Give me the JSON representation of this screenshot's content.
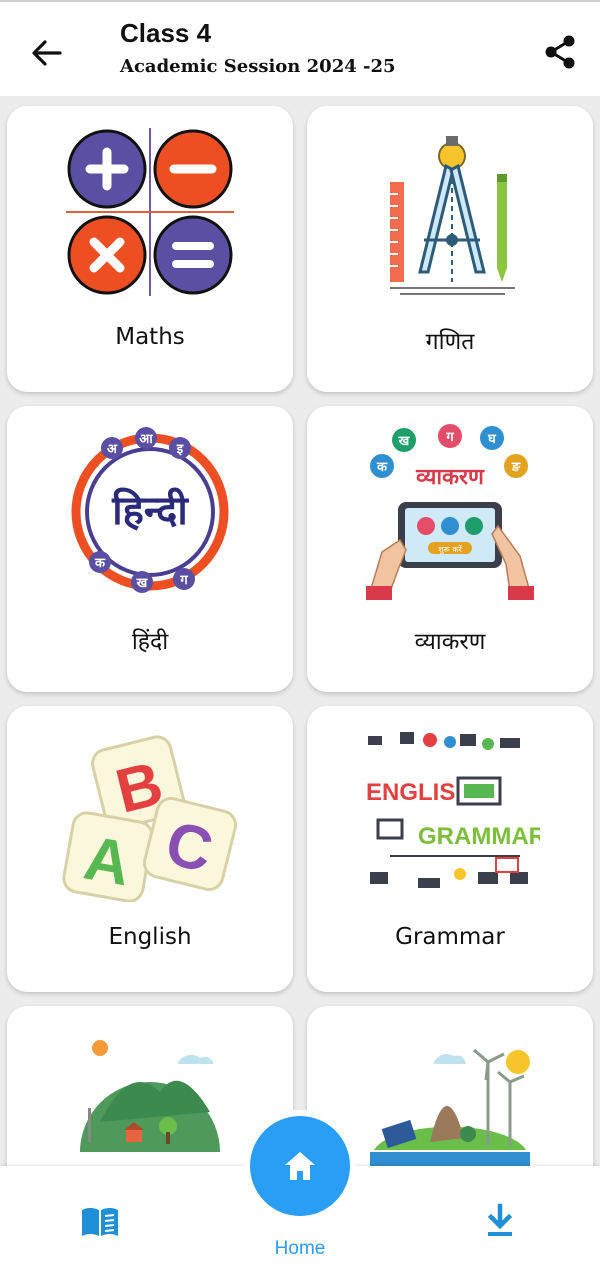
{
  "header": {
    "title": "Class 4",
    "subtitle": "Academic Session 2024 -25",
    "back_icon": "arrow-left-icon",
    "share_icon": "share-icon"
  },
  "cards": [
    {
      "label": "Maths",
      "icon": "math-operators-icon"
    },
    {
      "label": "गणित",
      "icon": "compass-ruler-icon"
    },
    {
      "label": "हिंदी",
      "icon": "hindi-logo-icon",
      "art_text": "हिन्दी",
      "art_letters": [
        "अ",
        "आ",
        "इ",
        "क",
        "ख",
        "ग"
      ]
    },
    {
      "label": "व्याकरण",
      "icon": "vyakaran-tablet-icon",
      "art_text": "व्याकरण",
      "art_letters": [
        "क",
        "ख",
        "ग",
        "घ",
        "ङ"
      ],
      "art_button": "शुरू करें"
    },
    {
      "label": "English",
      "icon": "abc-blocks-icon",
      "art_letters": [
        "B",
        "A",
        "C"
      ]
    },
    {
      "label": "Grammar",
      "icon": "english-grammar-icon",
      "art_text_1": "ENGLISH",
      "art_text_2": "GRAMMARA"
    },
    {
      "label": "",
      "icon": "earth-environment-icon"
    },
    {
      "label": "",
      "icon": "earth-renewable-energy-icon"
    }
  ],
  "bottom_nav": {
    "home_label": "Home",
    "left_icon": "book-icon",
    "right_icon": "download-icon",
    "accent": "#2a9df4"
  }
}
